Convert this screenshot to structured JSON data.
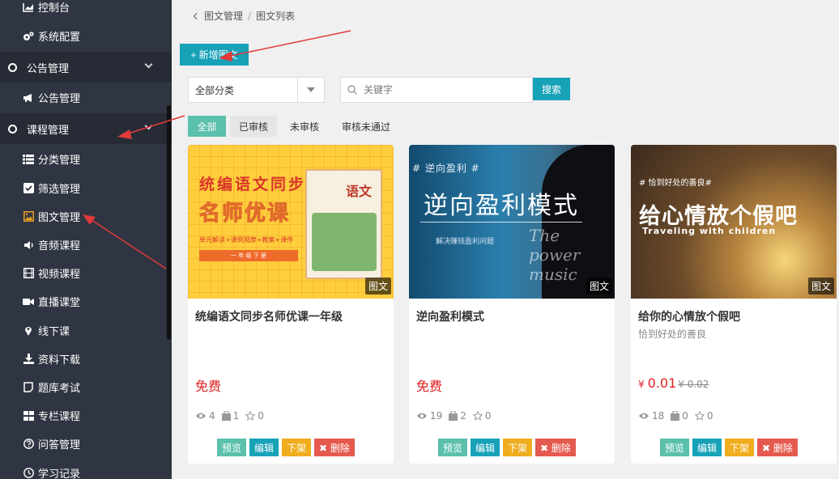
{
  "sidebar": {
    "items": [
      {
        "label": "控制台",
        "icon": "chart-icon",
        "type": "item"
      },
      {
        "label": "系统配置",
        "icon": "gears-icon",
        "type": "item"
      },
      {
        "label": "公告管理",
        "icon": "circle-icon",
        "type": "group"
      },
      {
        "label": "公告管理",
        "icon": "megaphone-icon",
        "type": "item"
      },
      {
        "label": "课程管理",
        "icon": "circle-icon",
        "type": "group"
      },
      {
        "label": "分类管理",
        "icon": "grid-list-icon",
        "type": "item"
      },
      {
        "label": "筛选管理",
        "icon": "checkbox-icon",
        "type": "item"
      },
      {
        "label": "图文管理",
        "icon": "image-icon",
        "type": "item",
        "active": true
      },
      {
        "label": "音频课程",
        "icon": "speaker-icon",
        "type": "item"
      },
      {
        "label": "视频课程",
        "icon": "film-icon",
        "type": "item"
      },
      {
        "label": "直播课堂",
        "icon": "video-camera-icon",
        "type": "item"
      },
      {
        "label": "线下课",
        "icon": "map-pin-icon",
        "type": "item"
      },
      {
        "label": "资料下载",
        "icon": "download-icon",
        "type": "item"
      },
      {
        "label": "题库考试",
        "icon": "note-icon",
        "type": "item"
      },
      {
        "label": "专栏课程",
        "icon": "grid-icon",
        "type": "item"
      },
      {
        "label": "问答管理",
        "icon": "question-icon",
        "type": "item"
      },
      {
        "label": "学习记录",
        "icon": "clock-icon",
        "type": "item"
      }
    ]
  },
  "breadcrumb": {
    "parent": "图文管理",
    "current": "图文列表"
  },
  "toolbar": {
    "add_label": "+ 新增图文"
  },
  "filter": {
    "category": "全部分类",
    "search_placeholder": "关键字",
    "search_label": "搜索"
  },
  "tabs": [
    "全部",
    "已审核",
    "未审核",
    "审核未通过"
  ],
  "cards": [
    {
      "title": "统编语文同步名师优课一年级",
      "subtitle": "",
      "price": "免费",
      "badge": "图文",
      "views": "4",
      "lessons": "1",
      "stars": "0",
      "cover": {
        "line1": "统编语文同步",
        "line2": "名师优课",
        "line3": "单元解读+课例观摩+教案+课件",
        "line4": "一 年 级 下 册",
        "book_title": "语文"
      }
    },
    {
      "title": "逆向盈利模式",
      "subtitle": "",
      "price": "免费",
      "badge": "图文",
      "views": "19",
      "lessons": "2",
      "stars": "0",
      "cover": {
        "tag": "# 逆向盈利 #",
        "big": "逆向盈利模式",
        "small": "解决赚钱盈利问题",
        "script": "The power music"
      }
    },
    {
      "title": "给你的心情放个假吧",
      "subtitle": "恰到好处的善良",
      "price_currency": "¥",
      "price": "0.01",
      "old_price": "¥ 0.02",
      "badge": "图文",
      "views": "18",
      "lessons": "0",
      "stars": "0",
      "cover": {
        "tag": "# 恰到好处的善良#",
        "big": "给心情放个假吧",
        "en": "Traveling with children"
      }
    }
  ],
  "actions": {
    "preview": "预览",
    "edit": "编辑",
    "off_shelf": "下架",
    "delete": "✖ 删除"
  },
  "colors": {
    "sidebar_bg": "#2f3542",
    "accent": "#17a2b8",
    "green": "#5bc0ac",
    "orange": "#f0ad1e",
    "red": "#e55a4e",
    "annotation": "#e03a3a"
  }
}
